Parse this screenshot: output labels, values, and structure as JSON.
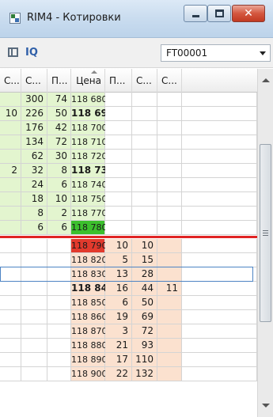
{
  "window": {
    "title": "RIM4 - Котировки",
    "close_glyph": "✕"
  },
  "toolbar": {
    "label": "IQ",
    "account": "FT00001"
  },
  "colors": {
    "bid_bg": "#e3f5cf",
    "ask_bg": "#fbe1cf",
    "best_bid_bg": "#3cbf2d",
    "best_ask_bg": "#e23a2d",
    "separator": "#e02424"
  },
  "columns": [
    "С...",
    "С...",
    "П...",
    "Цена",
    "П...",
    "С...",
    "С..."
  ],
  "rows": [
    {
      "side": "bid",
      "c1": "",
      "c2": "300",
      "c3": "74",
      "price": "118 680",
      "c5": "",
      "c6": "",
      "c7": "",
      "bold": false,
      "best": false
    },
    {
      "side": "bid",
      "c1": "10",
      "c2": "226",
      "c3": "50",
      "price": "118 690",
      "c5": "",
      "c6": "",
      "c7": "",
      "bold": true,
      "best": false
    },
    {
      "side": "bid",
      "c1": "",
      "c2": "176",
      "c3": "42",
      "price": "118 700",
      "c5": "",
      "c6": "",
      "c7": "",
      "bold": false,
      "best": false
    },
    {
      "side": "bid",
      "c1": "",
      "c2": "134",
      "c3": "72",
      "price": "118 710",
      "c5": "",
      "c6": "",
      "c7": "",
      "bold": false,
      "best": false
    },
    {
      "side": "bid",
      "c1": "",
      "c2": "62",
      "c3": "30",
      "price": "118 720",
      "c5": "",
      "c6": "",
      "c7": "",
      "bold": false,
      "best": false
    },
    {
      "side": "bid",
      "c1": "2",
      "c2": "32",
      "c3": "8",
      "price": "118 730",
      "c5": "",
      "c6": "",
      "c7": "",
      "bold": true,
      "best": false
    },
    {
      "side": "bid",
      "c1": "",
      "c2": "24",
      "c3": "6",
      "price": "118 740",
      "c5": "",
      "c6": "",
      "c7": "",
      "bold": false,
      "best": false
    },
    {
      "side": "bid",
      "c1": "",
      "c2": "18",
      "c3": "10",
      "price": "118 750",
      "c5": "",
      "c6": "",
      "c7": "",
      "bold": false,
      "best": false
    },
    {
      "side": "bid",
      "c1": "",
      "c2": "8",
      "c3": "2",
      "price": "118 770",
      "c5": "",
      "c6": "",
      "c7": "",
      "bold": false,
      "best": false
    },
    {
      "side": "bid",
      "c1": "",
      "c2": "6",
      "c3": "6",
      "price": "118 780",
      "c5": "",
      "c6": "",
      "c7": "",
      "bold": false,
      "best": true
    },
    {
      "side": "ask",
      "c1": "",
      "c2": "",
      "c3": "",
      "price": "118 790",
      "c5": "10",
      "c6": "10",
      "c7": "",
      "bold": false,
      "best": true
    },
    {
      "side": "ask",
      "c1": "",
      "c2": "",
      "c3": "",
      "price": "118 820",
      "c5": "5",
      "c6": "15",
      "c7": "",
      "bold": false,
      "best": false
    },
    {
      "side": "ask",
      "c1": "",
      "c2": "",
      "c3": "",
      "price": "118 830",
      "c5": "13",
      "c6": "28",
      "c7": "",
      "bold": false,
      "best": false,
      "selected": true
    },
    {
      "side": "ask",
      "c1": "",
      "c2": "",
      "c3": "",
      "price": "118 840",
      "c5": "16",
      "c6": "44",
      "c7": "11",
      "bold": true,
      "best": false
    },
    {
      "side": "ask",
      "c1": "",
      "c2": "",
      "c3": "",
      "price": "118 850",
      "c5": "6",
      "c6": "50",
      "c7": "",
      "bold": false,
      "best": false
    },
    {
      "side": "ask",
      "c1": "",
      "c2": "",
      "c3": "",
      "price": "118 860",
      "c5": "19",
      "c6": "69",
      "c7": "",
      "bold": false,
      "best": false
    },
    {
      "side": "ask",
      "c1": "",
      "c2": "",
      "c3": "",
      "price": "118 870",
      "c5": "3",
      "c6": "72",
      "c7": "",
      "bold": false,
      "best": false
    },
    {
      "side": "ask",
      "c1": "",
      "c2": "",
      "c3": "",
      "price": "118 880",
      "c5": "21",
      "c6": "93",
      "c7": "",
      "bold": false,
      "best": false
    },
    {
      "side": "ask",
      "c1": "",
      "c2": "",
      "c3": "",
      "price": "118 890",
      "c5": "17",
      "c6": "110",
      "c7": "",
      "bold": false,
      "best": false
    },
    {
      "side": "ask",
      "c1": "",
      "c2": "",
      "c3": "",
      "price": "118 900",
      "c5": "22",
      "c6": "132",
      "c7": "",
      "bold": false,
      "best": false
    }
  ]
}
